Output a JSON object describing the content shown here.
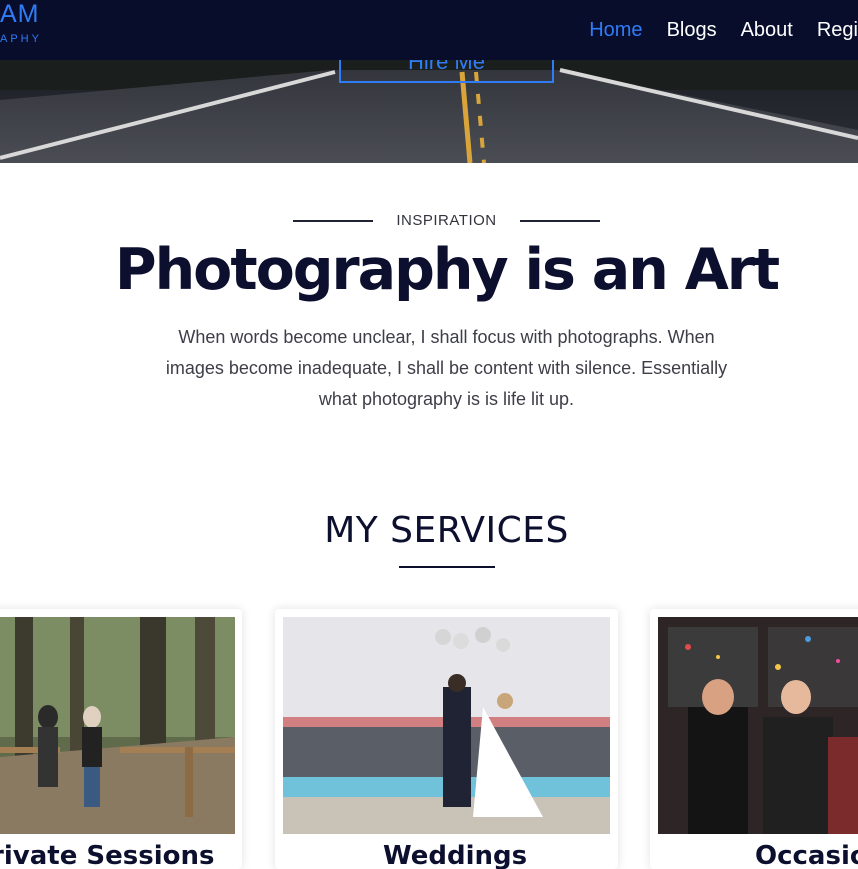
{
  "nav": {
    "brand_main": "AM",
    "brand_sub": "APHY",
    "links": [
      "Home",
      "Blogs",
      "About",
      "Regi"
    ],
    "active_color": "#2f7cf6",
    "background": "#080d2c"
  },
  "hero": {
    "button_label": "Hire Me"
  },
  "inspiration": {
    "eyebrow": "INSPIRATION",
    "headline": "Photography is an Art",
    "quote": "When words become unclear, I shall focus with photographs. When images become inadequate, I shall be content with silence. Essentially what photography is is life lit up."
  },
  "services": {
    "title": "MY SERVICES",
    "cards": [
      {
        "title": "Private Sessions"
      },
      {
        "title": "Weddings"
      },
      {
        "title": "Occasions"
      }
    ]
  }
}
